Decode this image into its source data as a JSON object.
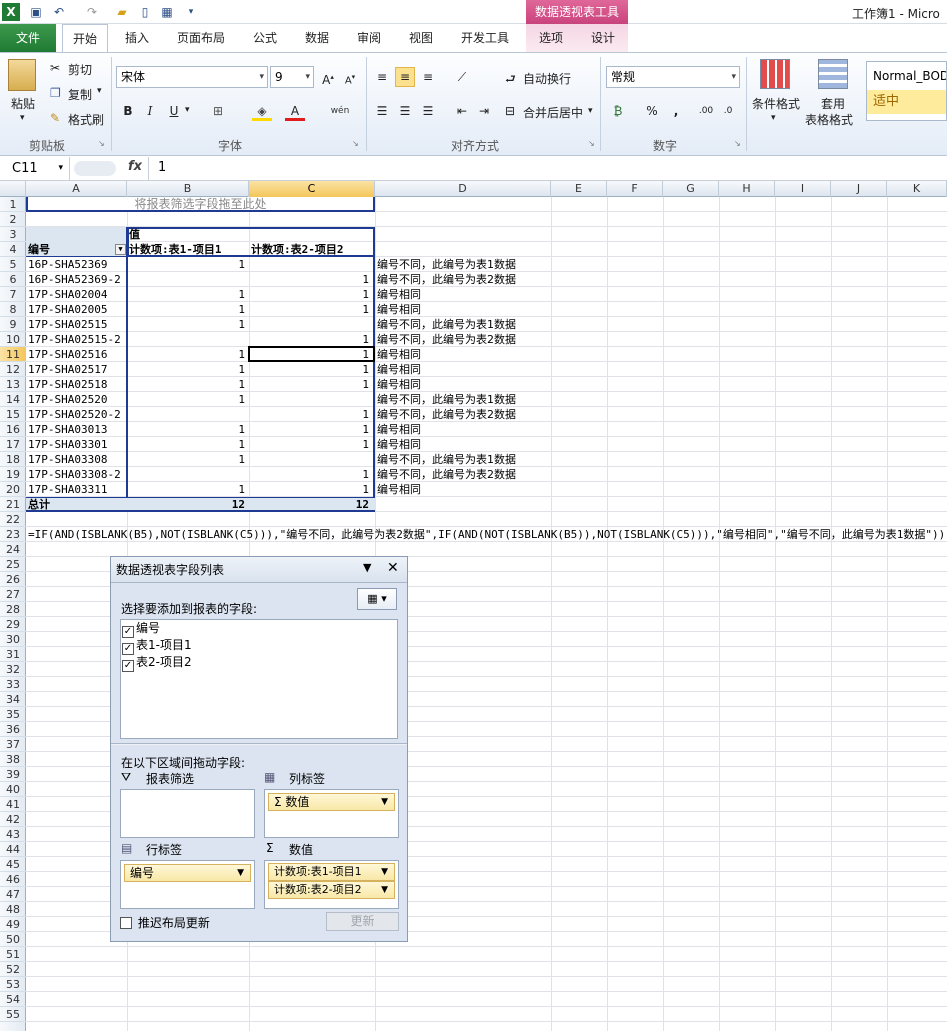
{
  "title_bar": {
    "context_tool": "数据透视表工具",
    "window_title": "工作簿1 - Micro"
  },
  "tabs": {
    "file": "文件",
    "home": "开始",
    "insert": "插入",
    "page_layout": "页面布局",
    "formulas": "公式",
    "data": "数据",
    "review": "审阅",
    "view": "视图",
    "developer": "开发工具",
    "options": "选项",
    "design": "设计"
  },
  "ribbon": {
    "clipboard": {
      "paste": "粘贴",
      "cut": "剪切",
      "copy": "复制",
      "format_painter": "格式刷",
      "label": "剪贴板"
    },
    "font": {
      "name": "宋体",
      "size": "9",
      "label": "字体"
    },
    "align": {
      "wrap": "自动换行",
      "merge": "合并后居中",
      "label": "对齐方式"
    },
    "number": {
      "format": "常规",
      "label": "数字"
    },
    "styles": {
      "cond_format": "条件格式",
      "table_format_1": "套用",
      "table_format_2": "表格格式",
      "style_normal": "Normal_BOD",
      "style_neutral": "适中"
    }
  },
  "formula_bar": {
    "cell_ref": "C11",
    "fx": "fx",
    "content": "1"
  },
  "columns": [
    "A",
    "B",
    "C",
    "D",
    "E",
    "F",
    "G",
    "H",
    "I",
    "J",
    "K"
  ],
  "row_numbers": [
    "1",
    "2",
    "3",
    "4",
    "5",
    "6",
    "7",
    "8",
    "9",
    "10",
    "11",
    "12",
    "13",
    "14",
    "15",
    "16",
    "17",
    "18",
    "19",
    "20",
    "21",
    "22",
    "23",
    "24",
    "25",
    "26",
    "27",
    "28",
    "29",
    "30",
    "31",
    "32",
    "33",
    "34",
    "35",
    "36",
    "37",
    "38",
    "39",
    "40",
    "41",
    "42",
    "43",
    "44",
    "45",
    "46",
    "47",
    "48",
    "49",
    "50",
    "51",
    "52",
    "53",
    "54",
    "55"
  ],
  "sheet": {
    "filter_drop": "将报表筛选字段拖至此处",
    "values_header": "值",
    "row_label_header": "编号",
    "col_b_header": "计数项:表1-项目1",
    "col_c_header": "计数项:表2-项目2",
    "rows": [
      {
        "id": "16P-SHA52369",
        "b": "1",
        "c": "",
        "d": "编号不同，此编号为表1数据"
      },
      {
        "id": "16P-SHA52369-2",
        "b": "",
        "c": "1",
        "d": "编号不同，此编号为表2数据"
      },
      {
        "id": "17P-SHA02004",
        "b": "1",
        "c": "1",
        "d": "编号相同"
      },
      {
        "id": "17P-SHA02005",
        "b": "1",
        "c": "1",
        "d": "编号相同"
      },
      {
        "id": "17P-SHA02515",
        "b": "1",
        "c": "",
        "d": "编号不同，此编号为表1数据"
      },
      {
        "id": "17P-SHA02515-2",
        "b": "",
        "c": "1",
        "d": "编号不同，此编号为表2数据"
      },
      {
        "id": "17P-SHA02516",
        "b": "1",
        "c": "1",
        "d": "编号相同"
      },
      {
        "id": "17P-SHA02517",
        "b": "1",
        "c": "1",
        "d": "编号相同"
      },
      {
        "id": "17P-SHA02518",
        "b": "1",
        "c": "1",
        "d": "编号相同"
      },
      {
        "id": "17P-SHA02520",
        "b": "1",
        "c": "",
        "d": "编号不同，此编号为表1数据"
      },
      {
        "id": "17P-SHA02520-2",
        "b": "",
        "c": "1",
        "d": "编号不同，此编号为表2数据"
      },
      {
        "id": "17P-SHA03013",
        "b": "1",
        "c": "1",
        "d": "编号相同"
      },
      {
        "id": "17P-SHA03301",
        "b": "1",
        "c": "1",
        "d": "编号相同"
      },
      {
        "id": "17P-SHA03308",
        "b": "1",
        "c": "",
        "d": "编号不同，此编号为表1数据"
      },
      {
        "id": "17P-SHA03308-2",
        "b": "",
        "c": "1",
        "d": "编号不同，此编号为表2数据"
      },
      {
        "id": "17P-SHA03311",
        "b": "1",
        "c": "1",
        "d": "编号相同"
      }
    ],
    "total_label": "总计",
    "total_b": "12",
    "total_c": "12",
    "formula_text": "=IF(AND(ISBLANK(B5),NOT(ISBLANK(C5))),\"编号不同，此编号为表2数据\",IF(AND(NOT(ISBLANK(B5)),NOT(ISBLANK(C5))),\"编号相同\",\"编号不同，此编号为表1数据\"))"
  },
  "pivot_pane": {
    "title": "数据透视表字段列表",
    "choose_label": "选择要添加到报表的字段:",
    "fields": [
      "编号",
      "表1-项目1",
      "表2-项目2"
    ],
    "drag_label": "在以下区域间拖动字段:",
    "report_filter": "报表筛选",
    "column_labels": "列标签",
    "column_item": "数值",
    "row_labels": "行标签",
    "row_item": "编号",
    "values": "数值",
    "value_items": [
      "计数项:表1-项目1",
      "计数项:表2-项目2"
    ],
    "defer_label": "推迟布局更新",
    "update_button": "更新"
  }
}
